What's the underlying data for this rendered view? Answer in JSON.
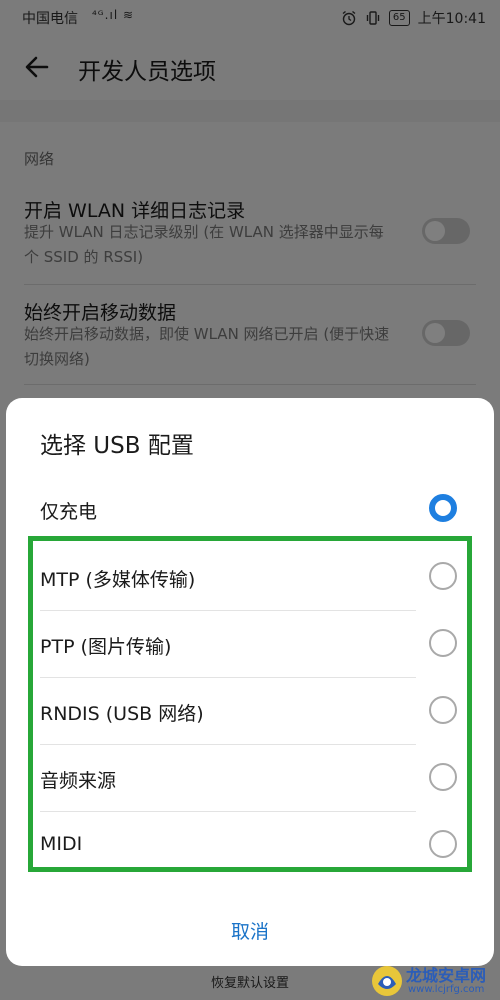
{
  "status_bar": {
    "carrier": "中国电信",
    "signal": "⁴ᴳ.ıl ≋",
    "battery": "65",
    "time": "上午10:41"
  },
  "app_bar": {
    "title": "开发人员选项"
  },
  "settings": {
    "section_header": "网络",
    "items": [
      {
        "title": "开启 WLAN 详细日志记录",
        "summary": "提升 WLAN 日志记录级别 (在 WLAN 选择器中显示每个 SSID 的 RSSI)",
        "enabled": false
      },
      {
        "title": "始终开启移动数据",
        "summary": "始终开启移动数据，即使 WLAN 网络已开启 (便于快速切换网络)",
        "enabled": false
      }
    ]
  },
  "dialog": {
    "title": "选择 USB 配置",
    "options": [
      {
        "label": "仅充电",
        "selected": true
      },
      {
        "label": "MTP (多媒体传输)",
        "selected": false
      },
      {
        "label": "PTP (图片传输)",
        "selected": false
      },
      {
        "label": "RNDIS (USB 网络)",
        "selected": false
      },
      {
        "label": "音频来源",
        "selected": false
      },
      {
        "label": "MIDI",
        "selected": false
      }
    ],
    "cancel_label": "取消",
    "highlight_color": "#27a738",
    "accent_color": "#1e7fe0"
  },
  "bottom_bar": {
    "reset_label": "恢复默认设置"
  },
  "watermark": {
    "title": "龙城安卓网",
    "url": "www.lcjrfg.com"
  },
  "icons": {
    "back": "arrow-left-icon",
    "alarm": "alarm-icon",
    "vibrate": "vibrate-icon",
    "radio_selected": "radio-checked-icon",
    "radio_unselected": "radio-unchecked-icon"
  }
}
